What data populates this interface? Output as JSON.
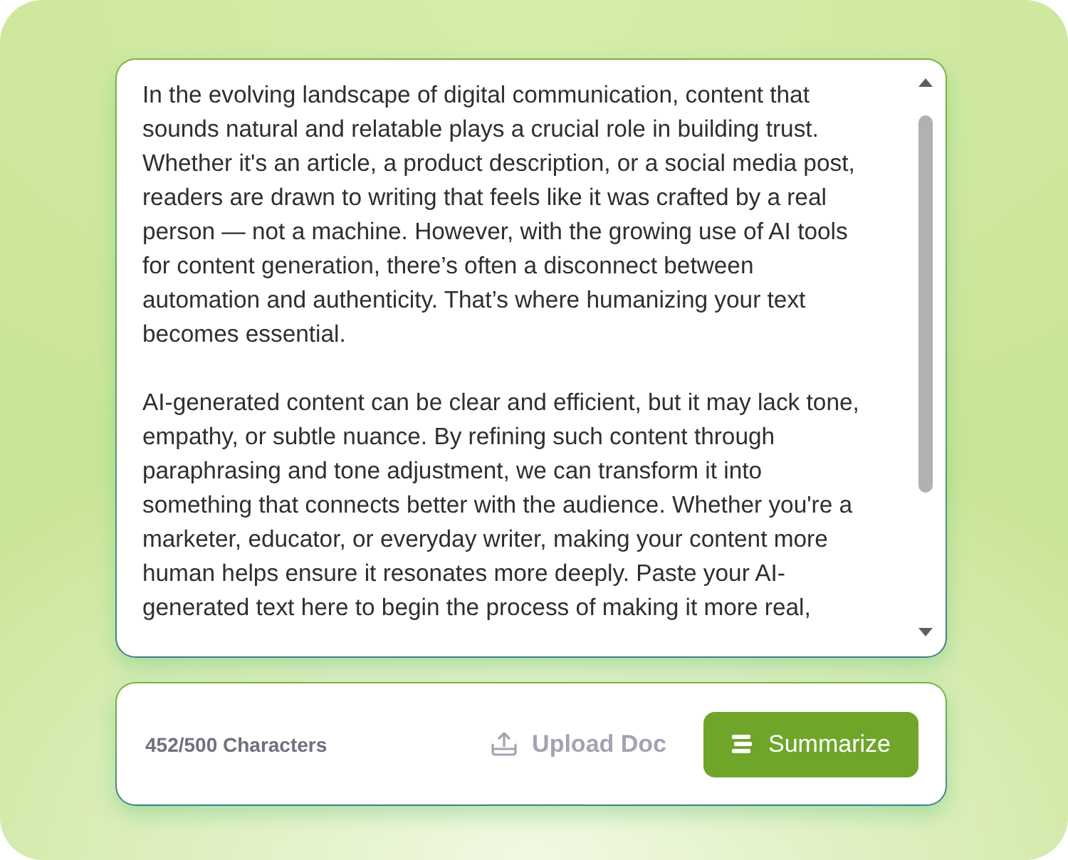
{
  "editor": {
    "paragraphs": [
      "In the evolving landscape of digital communication, content that sounds natural and relatable plays a crucial role in building trust. Whether it's an article, a product description, or a social media post, readers are drawn to writing that feels like it was crafted by a real person — not a machine. However, with the growing use of AI tools for content generation, there’s often a disconnect between automation and authenticity. That’s where humanizing your text becomes essential.",
      "AI-generated content can be clear and efficient, but it may lack tone, empathy, or subtle nuance. By refining such content through paraphrasing and tone adjustment, we can transform it into something that connects better with the audience. Whether you're a marketer, educator, or everyday writer, making your content more human helps ensure it resonates more deeply. Paste your AI-generated text here to begin the process of making it more real,"
    ]
  },
  "footer": {
    "character_count": "452/500 Characters",
    "buttons": [
      {
        "kind": "upload",
        "label": "Upload Doc"
      },
      {
        "kind": "summarize",
        "label": "Summarize"
      }
    ]
  }
}
